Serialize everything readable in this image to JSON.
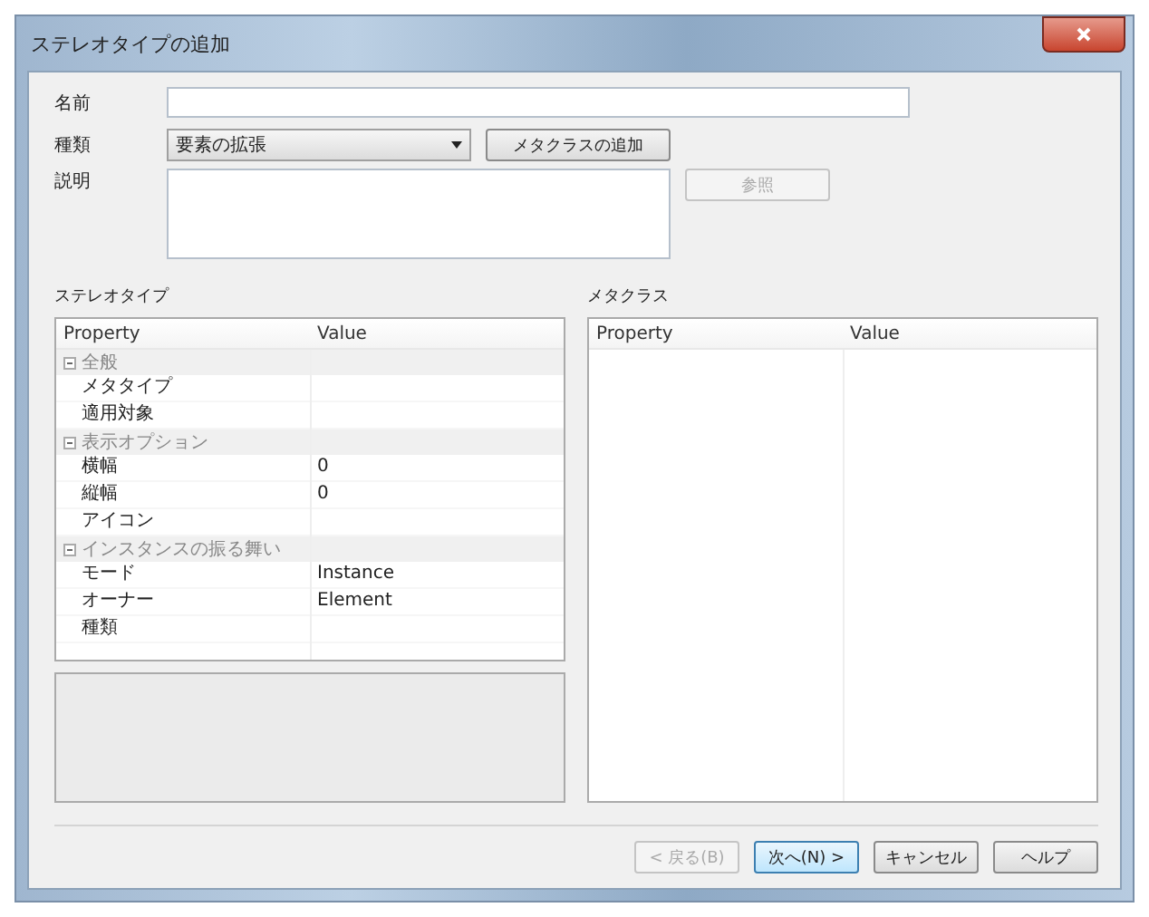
{
  "window": {
    "title": "ステレオタイプの追加"
  },
  "form": {
    "name_label": "名前",
    "type_label": "種類",
    "type_value": "要素の拡張",
    "add_metaclass_button": "メタクラスの追加",
    "description_label": "説明",
    "browse_button": {
      "label": "参照",
      "disabled": true
    }
  },
  "stereotype": {
    "title": "ステレオタイプ",
    "columns": [
      "Property",
      "Value"
    ],
    "groups": [
      {
        "label": "全般",
        "expanded": true,
        "rows": [
          {
            "property": "メタタイプ",
            "value": ""
          },
          {
            "property": "適用対象",
            "value": ""
          }
        ]
      },
      {
        "label": "表示オプション",
        "expanded": true,
        "rows": [
          {
            "property": "横幅",
            "value": "0"
          },
          {
            "property": "縦幅",
            "value": "0"
          },
          {
            "property": "アイコン",
            "value": ""
          }
        ]
      },
      {
        "label": "インスタンスの振る舞い",
        "expanded": true,
        "rows": [
          {
            "property": "モード",
            "value": "Instance"
          },
          {
            "property": "オーナー",
            "value": "Element"
          },
          {
            "property": "種類",
            "value": ""
          }
        ]
      }
    ]
  },
  "metaclass": {
    "title": "メタクラス",
    "columns": [
      "Property",
      "Value"
    ]
  },
  "buttons": [
    {
      "label": "< 戻る(B)",
      "disabled": true,
      "default": false
    },
    {
      "label": "次へ(N) >",
      "disabled": false,
      "default": true
    },
    {
      "label": "キャンセル",
      "disabled": false,
      "default": false
    },
    {
      "label": "ヘルプ",
      "disabled": false,
      "default": false
    }
  ]
}
